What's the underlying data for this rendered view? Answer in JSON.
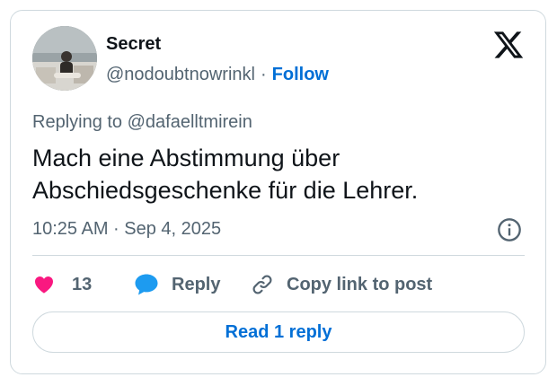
{
  "author": {
    "name": "Secret",
    "handle": "@nodoubtnowrinkl",
    "separator": "·",
    "follow_label": "Follow"
  },
  "icons": {
    "brand": "x-logo-icon",
    "info": "info-icon",
    "like": "heart-icon",
    "reply": "speech-bubble-icon",
    "copy": "link-icon"
  },
  "tweet": {
    "replying_to": "Replying to @dafaelltmirein",
    "text": "Mach eine Abstimmung über Abschiedsgeschenke für die Lehrer.",
    "timestamp": "10:25 AM · Sep 4, 2025"
  },
  "actions": {
    "like_count": "13",
    "reply_label": "Reply",
    "copy_label": "Copy link to post"
  },
  "read_replies_label": "Read 1 reply",
  "colors": {
    "like": "#f91880",
    "reply": "#1d9bf0",
    "link": "#006fd6",
    "muted": "#536471",
    "border": "#cfd9de"
  }
}
